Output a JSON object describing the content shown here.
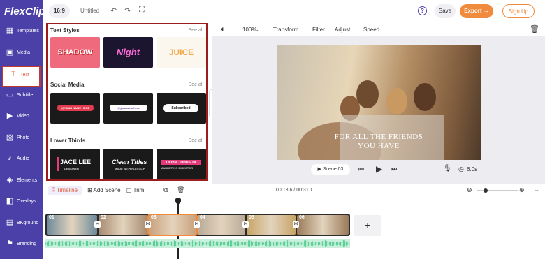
{
  "brand": {
    "logo_text": "FlexClip",
    "accent": "#4b40a8",
    "orange": "#f08a3c"
  },
  "sidebar": {
    "items": [
      {
        "label": "Templates",
        "icon": "templates-icon"
      },
      {
        "label": "Media",
        "icon": "media-icon"
      },
      {
        "label": "Text",
        "icon": "text-icon"
      },
      {
        "label": "Subtitle",
        "icon": "subtitle-icon"
      },
      {
        "label": "Video",
        "icon": "video-icon"
      },
      {
        "label": "Photo",
        "icon": "photo-icon"
      },
      {
        "label": "Audio",
        "icon": "audio-icon"
      },
      {
        "label": "Elements",
        "icon": "elements-icon"
      },
      {
        "label": "Overlays",
        "icon": "overlays-icon"
      },
      {
        "label": "BKground",
        "icon": "background-icon"
      },
      {
        "label": "Branding",
        "icon": "branding-icon"
      }
    ],
    "active": "Text"
  },
  "topbar": {
    "ratio": "16:9",
    "project_title": "Untitled",
    "save_label": "Save",
    "export_label": "Export →",
    "signup_label": "Sign Up"
  },
  "panel": {
    "sections": [
      {
        "title": "Text Styles",
        "see_all": "See all",
        "thumbs": [
          "SHADOW",
          "Night",
          "JUICE"
        ]
      },
      {
        "title": "Social Media",
        "see_all": "See all",
        "thumbs": [
          "@YOUR NAME HERE",
          "@yournamehere",
          "Subscribed"
        ]
      },
      {
        "title": "Lower Thirds",
        "see_all": "See all",
        "thumbs": [
          "JACE LEE",
          "Clean Titles",
          "OLIVIA JOHNSON"
        ]
      }
    ],
    "lower_sub": [
      "DESIGNER",
      "MADE WITH FLEXCLIP",
      "MARKETING DIRECTOR"
    ]
  },
  "toolbar": {
    "zoom": "100%",
    "transform": "Transform",
    "filter": "Filter",
    "adjust": "Adjust",
    "speed": "Speed"
  },
  "preview": {
    "caption_line1": "FOR ALL THE FRIENDS",
    "caption_line2": "YOU HAVE",
    "scene": "Scene 03",
    "duration": "6.0s"
  },
  "timeline": {
    "tab_timeline": "Timeline",
    "add_scene": "Add Scene",
    "trim": "Trim",
    "time": "00:13.6 / 00:31.1",
    "clips": [
      "01",
      "02",
      "03",
      "04",
      "05",
      "06"
    ],
    "add_label": "+",
    "zoom_level": 0.2
  }
}
